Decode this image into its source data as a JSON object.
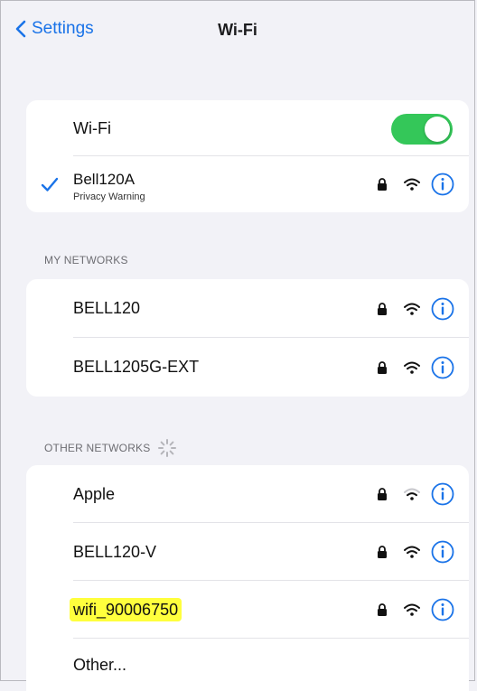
{
  "nav": {
    "back_label": "Settings",
    "title": "Wi-Fi"
  },
  "wifi_toggle": {
    "label": "Wi-Fi",
    "on": true,
    "color": "#34c759"
  },
  "connected": {
    "name": "Bell120A",
    "subtitle": "Privacy Warning"
  },
  "my_networks": {
    "header": "MY NETWORKS",
    "items": [
      {
        "name": "BELL120"
      },
      {
        "name": "BELL1205G-EXT"
      }
    ]
  },
  "other_networks": {
    "header": "OTHER NETWORKS",
    "items": [
      {
        "name": "Apple"
      },
      {
        "name": "BELL120-V"
      },
      {
        "name": "wifi_90006750",
        "highlighted": true
      },
      {
        "name": "Other..."
      }
    ]
  },
  "colors": {
    "accent": "#1a73e8",
    "toggle": "#34c759",
    "highlight": "#ffff3d"
  }
}
